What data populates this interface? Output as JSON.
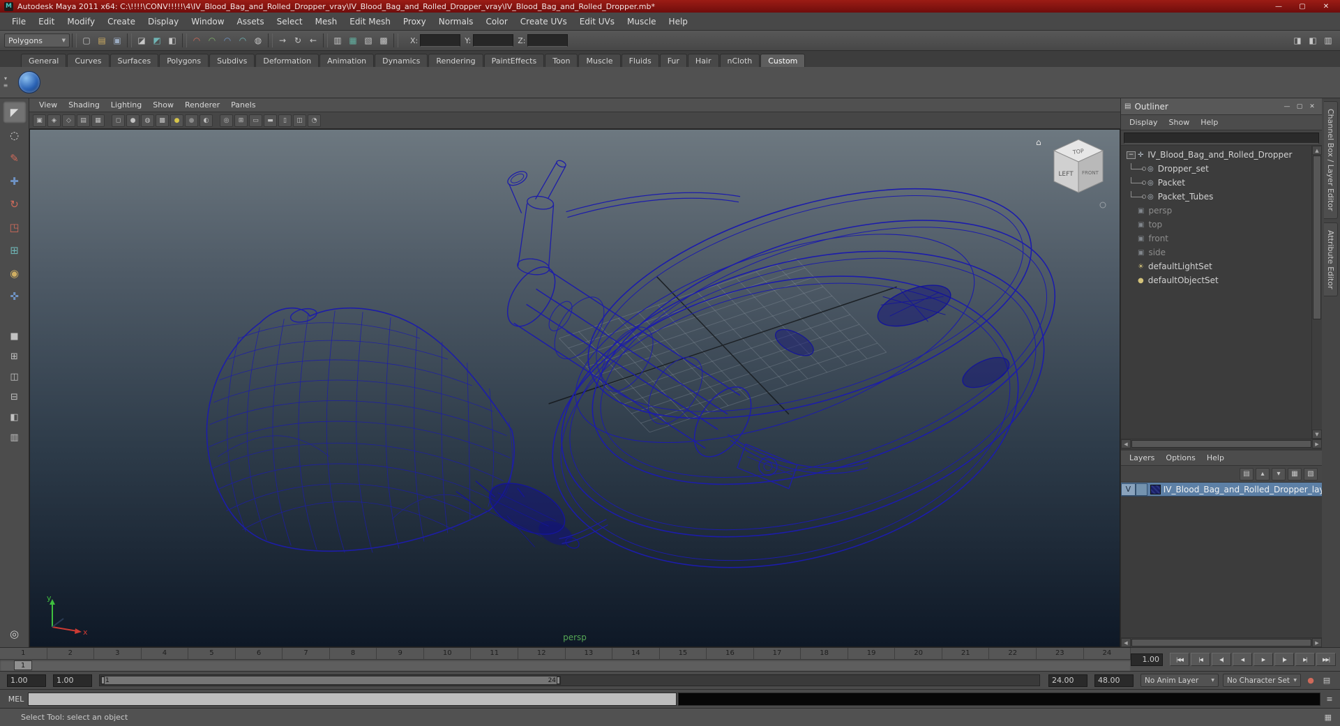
{
  "window": {
    "title": "Autodesk Maya 2011 x64: C:\\!!!!\\CONV!!!!!\\4\\IV_Blood_Bag_and_Rolled_Dropper_vray\\IV_Blood_Bag_and_Rolled_Dropper_vray\\IV_Blood_Bag_and_Rolled_Dropper.mb*",
    "app_icon": "M",
    "controls": {
      "minimize": "—",
      "maximize": "▢",
      "close": "✕"
    }
  },
  "menubar": [
    "File",
    "Edit",
    "Modify",
    "Create",
    "Display",
    "Window",
    "Assets",
    "Select",
    "Mesh",
    "Edit Mesh",
    "Proxy",
    "Normals",
    "Color",
    "Create UVs",
    "Edit UVs",
    "Muscle",
    "Help"
  ],
  "statusline": {
    "mode": "Polygons",
    "mode_caret": "▼",
    "icons": [
      {
        "name": "statusline-grip",
        "cls": "sep"
      },
      {
        "name": "new-scene-icon",
        "glyph": "▢"
      },
      {
        "name": "open-scene-icon",
        "glyph": "▤",
        "cls": "c-amber"
      },
      {
        "name": "save-scene-icon",
        "glyph": "▣",
        "cls": "c-slate"
      },
      {
        "name": "statusline-grip",
        "cls": "sep"
      },
      {
        "name": "select-by-hierarchy-icon",
        "glyph": "◪"
      },
      {
        "name": "select-by-object-icon",
        "glyph": "◩",
        "cls": "c-cyan"
      },
      {
        "name": "select-by-component-icon",
        "glyph": "◧"
      },
      {
        "name": "statusline-grip",
        "cls": "sep"
      },
      {
        "name": "snap-to-grid-icon",
        "glyph": "◠",
        "cls": "c-red"
      },
      {
        "name": "snap-to-curve-icon",
        "glyph": "◠",
        "cls": "c-green"
      },
      {
        "name": "snap-to-point-icon",
        "glyph": "◠",
        "cls": "c-blue"
      },
      {
        "name": "snap-to-plane-icon",
        "glyph": "◠",
        "cls": "c-cyan"
      },
      {
        "name": "make-live-icon",
        "glyph": "◍"
      },
      {
        "name": "statusline-grip",
        "cls": "sep"
      },
      {
        "name": "input-connections-icon",
        "glyph": "→"
      },
      {
        "name": "construction-history-icon",
        "glyph": "↻"
      },
      {
        "name": "output-connections-icon",
        "glyph": "←"
      },
      {
        "name": "statusline-grip",
        "cls": "sep"
      },
      {
        "name": "open-render-view-icon",
        "glyph": "▥"
      },
      {
        "name": "render-current-frame-icon",
        "glyph": "▦",
        "cls": "c-teal"
      },
      {
        "name": "ipr-render-icon",
        "glyph": "▧"
      },
      {
        "name": "render-settings-icon",
        "glyph": "▩"
      },
      {
        "name": "statusline-grip",
        "cls": "sep"
      }
    ],
    "coord_fields": [
      {
        "name": "x-coordinate-field",
        "label": "X:"
      },
      {
        "name": "y-coordinate-field",
        "label": "Y:"
      },
      {
        "name": "z-coordinate-field",
        "label": "Z:"
      }
    ],
    "right_icons": [
      {
        "name": "show-attribute-editor-icon",
        "glyph": "◨"
      },
      {
        "name": "show-tool-settings-icon",
        "glyph": "◧"
      },
      {
        "name": "show-channel-box-icon",
        "glyph": "▥"
      }
    ]
  },
  "shelf": {
    "controls": [
      {
        "name": "shelf-tabs-toggle-icon",
        "glyph": "▾"
      },
      {
        "name": "shelf-menu-icon",
        "glyph": "≡"
      }
    ],
    "tabs": [
      {
        "label": "General"
      },
      {
        "label": "Curves"
      },
      {
        "label": "Surfaces"
      },
      {
        "label": "Polygons"
      },
      {
        "label": "Subdivs"
      },
      {
        "label": "Deformation"
      },
      {
        "label": "Animation"
      },
      {
        "label": "Dynamics"
      },
      {
        "label": "Rendering"
      },
      {
        "label": "PaintEffects"
      },
      {
        "label": "Toon"
      },
      {
        "label": "Muscle"
      },
      {
        "label": "Fluids"
      },
      {
        "label": "Fur"
      },
      {
        "label": "Hair"
      },
      {
        "label": "nCloth"
      },
      {
        "label": "Custom",
        "cls": "active",
        "name": "shelf-tab-custom"
      }
    ]
  },
  "toolbox": {
    "tools": [
      {
        "name": "select-tool",
        "glyph": "◤",
        "cls": "active"
      },
      {
        "name": "lasso-select-tool",
        "glyph": "◌"
      },
      {
        "name": "paint-select-tool",
        "glyph": "✎",
        "cls": "c-red"
      },
      {
        "name": "move-tool",
        "glyph": "✚",
        "cls": "c-blue"
      },
      {
        "name": "rotate-tool",
        "glyph": "↻",
        "cls": "c-red"
      },
      {
        "name": "scale-tool",
        "glyph": "◳",
        "cls": "c-red"
      },
      {
        "name": "universal-manipulator-tool",
        "glyph": "⊞",
        "cls": "c-cyan"
      },
      {
        "name": "soft-modification-tool",
        "glyph": "◉",
        "cls": "c-amber"
      },
      {
        "name": "show-manipulator-tool",
        "glyph": "✜",
        "cls": "c-blue"
      }
    ],
    "layouts": [
      {
        "name": "single-pane-layout-button",
        "glyph": "■"
      },
      {
        "name": "four-pane-layout-button",
        "glyph": "⊞"
      },
      {
        "name": "two-pane-side-layout-button",
        "glyph": "◫"
      },
      {
        "name": "two-pane-stacked-layout-button",
        "glyph": "⊟"
      },
      {
        "name": "three-pane-layout-button",
        "glyph": "◧"
      },
      {
        "name": "outliner-persp-layout-button",
        "glyph": "▥"
      }
    ],
    "extra_glyph": "◎"
  },
  "viewport": {
    "menus": [
      "View",
      "Shading",
      "Lighting",
      "Show",
      "Renderer",
      "Panels"
    ],
    "toolbar": [
      {
        "name": "select-camera-icon",
        "glyph": "▣"
      },
      {
        "name": "lock-camera-icon",
        "glyph": "◈"
      },
      {
        "name": "camera-attributes-icon",
        "glyph": "◇"
      },
      {
        "name": "bookmarks-icon",
        "glyph": "▤"
      },
      {
        "name": "image-plane-icon",
        "glyph": "▦"
      },
      {
        "name": "viewport-toolbar-gap",
        "cls": "sp"
      },
      {
        "name": "wireframe-icon",
        "glyph": "◻"
      },
      {
        "name": "smooth-shade-icon",
        "glyph": "●"
      },
      {
        "name": "wireframe-on-shaded-icon",
        "glyph": "◍"
      },
      {
        "name": "textured-icon",
        "glyph": "▩"
      },
      {
        "name": "use-all-lights-icon",
        "glyph": "●",
        "cls": "c-yellow"
      },
      {
        "name": "shadows-icon",
        "glyph": "●",
        "cls": "c-dim"
      },
      {
        "name": "screen-space-ao-icon",
        "glyph": "◐"
      },
      {
        "name": "viewport-toolbar-gap",
        "cls": "sp"
      },
      {
        "name": "isolate-select-icon",
        "glyph": "◎"
      },
      {
        "name": "field-chart-icon",
        "glyph": "⊞"
      },
      {
        "name": "resolution-gate-icon",
        "glyph": "▭"
      },
      {
        "name": "gate-mask-icon",
        "glyph": "▬"
      },
      {
        "name": "film-gate-icon",
        "glyph": "▯"
      },
      {
        "name": "xray-icon",
        "glyph": "◫"
      },
      {
        "name": "exposure-icon",
        "glyph": "◔"
      }
    ],
    "camera_label": "persp",
    "viewcube": {
      "top": "TOP",
      "left": "LEFT",
      "front": "FRONT",
      "home": "⌂"
    },
    "axis": {
      "y": "y",
      "x": "x"
    }
  },
  "outliner": {
    "title": "Outliner",
    "panel_icon": "▤",
    "controls": [
      {
        "name": "outliner-minimize-button",
        "glyph": "—"
      },
      {
        "name": "outliner-maximize-button",
        "glyph": "▢"
      },
      {
        "name": "outliner-close-button",
        "glyph": "✕"
      }
    ],
    "menus": [
      "Display",
      "Show",
      "Help"
    ],
    "items": [
      {
        "name": "outliner-item-root",
        "label": "IV_Blood_Bag_and_Rolled_Dropper",
        "icon": "✛",
        "cls": "root",
        "expander": "−"
      },
      {
        "name": "outliner-item-dropper-set",
        "label": "Dropper_set",
        "icon": "◎",
        "cls": "child"
      },
      {
        "name": "outliner-item-packet",
        "label": "Packet",
        "icon": "◎",
        "cls": "child"
      },
      {
        "name": "outliner-item-packet-tubes",
        "label": "Packet_Tubes",
        "icon": "◎",
        "cls": "child"
      },
      {
        "name": "outliner-item-persp",
        "label": "persp",
        "icon": "▣",
        "cls": "camera muted"
      },
      {
        "name": "outliner-item-top",
        "label": "top",
        "icon": "▣",
        "cls": "camera muted"
      },
      {
        "name": "outliner-item-front",
        "label": "front",
        "icon": "▣",
        "cls": "camera muted"
      },
      {
        "name": "outliner-item-side",
        "label": "side",
        "icon": "▣",
        "cls": "camera muted"
      },
      {
        "name": "outliner-item-default-light-set",
        "label": "defaultLightSet",
        "icon": "☀",
        "cls": "set"
      },
      {
        "name": "outliner-item-default-object-set",
        "label": "defaultObjectSet",
        "icon": "●",
        "cls": "set"
      }
    ]
  },
  "side_tabs": [
    {
      "label": "Channel Box / Layer Editor",
      "name": "tab-channel-box-layer-editor"
    },
    {
      "label": "Attribute Editor",
      "name": "tab-attribute-editor"
    }
  ],
  "layers": {
    "menus": [
      "Layers",
      "Options",
      "Help"
    ],
    "icons": [
      {
        "name": "layers-normal-mode-icon",
        "glyph": "▤"
      },
      {
        "name": "move-layer-up-icon",
        "glyph": "▴"
      },
      {
        "name": "move-layer-down-icon",
        "glyph": "▾"
      },
      {
        "name": "new-empty-layer-icon",
        "glyph": "▦"
      },
      {
        "name": "new-layer-from-selected-icon",
        "glyph": "▧"
      }
    ],
    "layer": {
      "visibility": "V",
      "name": "IV_Blood_Bag_and_Rolled_Dropper_layer"
    }
  },
  "timeline": {
    "ticks": [
      "1",
      "2",
      "3",
      "4",
      "5",
      "6",
      "7",
      "8",
      "9",
      "10",
      "11",
      "12",
      "13",
      "14",
      "15",
      "16",
      "17",
      "18",
      "19",
      "20",
      "21",
      "22",
      "23",
      "24"
    ],
    "current_frame": "1",
    "current_time": "1.00",
    "playback": [
      {
        "name": "go-to-start-button",
        "glyph": "|◀◀"
      },
      {
        "name": "step-back-frame-button",
        "glyph": "|◀"
      },
      {
        "name": "step-back-key-button",
        "glyph": "◀|"
      },
      {
        "name": "play-backwards-button",
        "glyph": "◀"
      },
      {
        "name": "play-forwards-button",
        "glyph": "▶"
      },
      {
        "name": "step-forward-key-button",
        "glyph": "|▶"
      },
      {
        "name": "step-forward-frame-button",
        "glyph": "▶|"
      },
      {
        "name": "go-to-end-button",
        "glyph": "▶▶|"
      }
    ]
  },
  "range_slider": {
    "anim_start": "1.00",
    "playback_start": "1.00",
    "range_start": "1",
    "range_end": "24",
    "playback_end": "24.00",
    "anim_end": "48.00",
    "anim_layer": "No Anim Layer",
    "character_set": "No Character Set",
    "caret": "▼",
    "auto_key_glyph": "●",
    "prefs_glyph": "▤"
  },
  "command": {
    "label": "MEL",
    "icon": "≡"
  },
  "help": {
    "text": "Select Tool: select an object",
    "icon": "▦"
  }
}
